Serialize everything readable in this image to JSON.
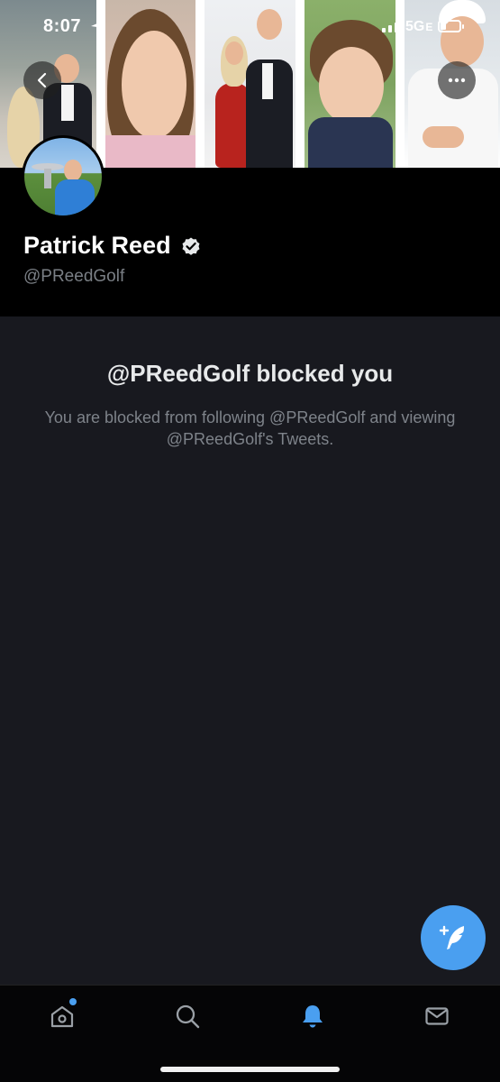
{
  "status_bar": {
    "time": "8:07",
    "network": "5G",
    "network_suffix": "E",
    "icons": [
      "location-arrow-icon",
      "signal-icon",
      "battery-icon"
    ]
  },
  "header": {
    "photos": [
      "couple-photo",
      "girl-photo",
      "couple-event-photo",
      "boy-photo",
      "golfer-photo"
    ],
    "back_icon": "chevron-left-icon",
    "more_icon": "ellipsis-icon"
  },
  "profile": {
    "name": "Patrick Reed",
    "handle": "@PReedGolf",
    "verified": true
  },
  "blocked": {
    "title": "@PReedGolf blocked you",
    "message": "You are blocked from following @PReedGolf and viewing @PReedGolf's Tweets."
  },
  "fab": {
    "icon": "compose-tweet-icon"
  },
  "tabbar": {
    "tabs": [
      {
        "name": "home",
        "icon": "home-icon",
        "active": false,
        "has_dot": true
      },
      {
        "name": "search",
        "icon": "search-icon",
        "active": false
      },
      {
        "name": "notifications",
        "icon": "bell-icon",
        "active": true
      },
      {
        "name": "messages",
        "icon": "mail-icon",
        "active": false
      }
    ]
  },
  "colors": {
    "accent": "#4a9ff0",
    "background": "#18191f",
    "profile_bg": "#000000",
    "secondary_text": "#7e838a"
  }
}
